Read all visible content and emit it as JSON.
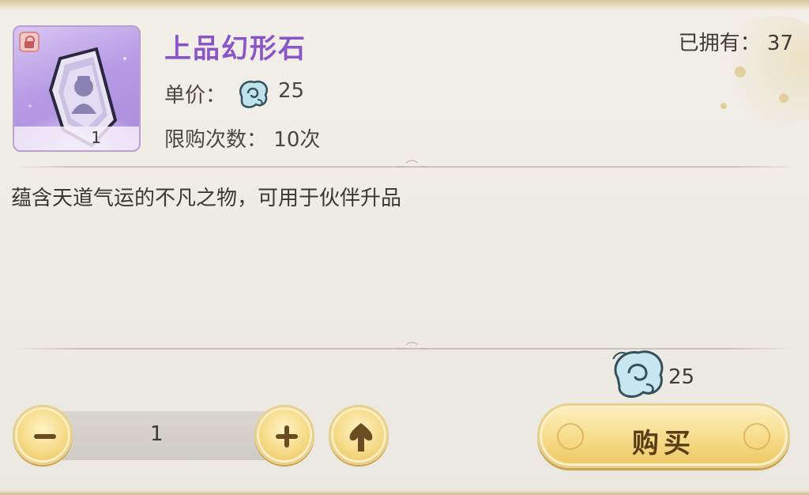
{
  "item": {
    "name": "上品幻形石",
    "icon_count": "1",
    "icon_name": "transform-stone-icon",
    "lock_icon": "lock-icon"
  },
  "owned": {
    "label": "已拥有：",
    "value": "37"
  },
  "price": {
    "label": "单价：",
    "currency_icon": "jade-currency-icon",
    "value": "25"
  },
  "limit": {
    "label": "限购次数：",
    "value": "10次"
  },
  "description": "蕴含天道气运的不凡之物，可用于伙伴升品",
  "purchase": {
    "total_cost": "25",
    "quantity": "1",
    "buy_label": "购买",
    "max_icon": "max-arrow-icon"
  },
  "colors": {
    "item_name": "#8a55c8",
    "button_gold": "#f6dc8a",
    "panel_bg": "#efece6"
  }
}
